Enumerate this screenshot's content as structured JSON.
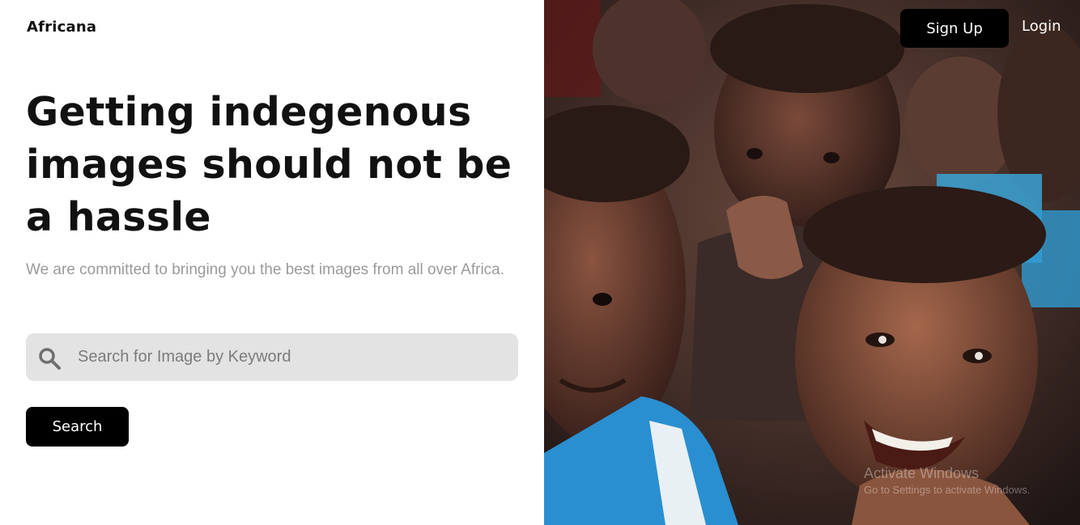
{
  "brand": {
    "name": "Africana"
  },
  "hero": {
    "headline": "Getting indegenous images should not be a hassle",
    "subtext": "We are committed to bringing you the best images from all over Africa."
  },
  "search": {
    "placeholder": "Search for Image by Keyword",
    "value": "",
    "button_label": "Search",
    "icon": "search-icon"
  },
  "nav": {
    "signup_label": "Sign Up",
    "login_label": "Login"
  },
  "watermark": {
    "title": "Activate Windows",
    "subtitle": "Go to Settings to activate Windows."
  },
  "colors": {
    "button_bg": "#000000",
    "search_bg": "#e3e3e3",
    "subtext": "#9a9a9a"
  }
}
